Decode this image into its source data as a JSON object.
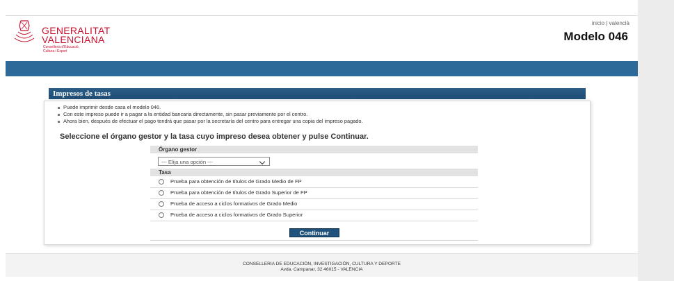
{
  "header": {
    "brand_line1": "GENERALITAT",
    "brand_line2": "VALENCIANA",
    "brand_sub1": "Conselleria d'Educació,",
    "brand_sub2": "Cultura i Esport",
    "top_links": [
      "inicio",
      "valencià"
    ],
    "top_links_separator": "|",
    "model_title": "Modelo 046"
  },
  "panel": {
    "title": "Impresos de tasas",
    "bullets": [
      "Puede imprimir desde casa el modelo 046.",
      "Con este impreso puede ir a pagar a la entidad bancaria directamente, sin pasar previamente por el centro.",
      "Ahora bien, después de efectuar el pago tendrá que pasar por la secretaría del centro para entregar una copia del impreso pagado."
    ],
    "instruction": "Seleccione el órgano gestor y la tasa cuyo impreso desea obtener y pulse Continuar."
  },
  "form": {
    "organo_label": "Órgano gestor",
    "select_value": "--- Elija una opción ---",
    "tasa_label": "Tasa",
    "radio_options": [
      "Prueba para obtención de títulos de Grado Medio de FP",
      "Prueba para obtención de títulos de Grado Superior de FP",
      "Prueba de acceso a ciclos formativos de Grado Medio",
      "Prueba de acceso a ciclos formativos de Grado Superior"
    ],
    "continue_label": "Continuar"
  },
  "footer": {
    "line1": "CONSELLERIA DE EDUCACIÓN, INVESTIGACIÓN, CULTURA Y DEPORTE",
    "line2": "Avda. Campanar, 32 46015 - VALENCIA"
  },
  "colors": {
    "brand_red": "#c8102e",
    "header_blue": "#2d6a99",
    "panel_title_blue": "#1e4d74",
    "button_blue": "#1f527c"
  }
}
